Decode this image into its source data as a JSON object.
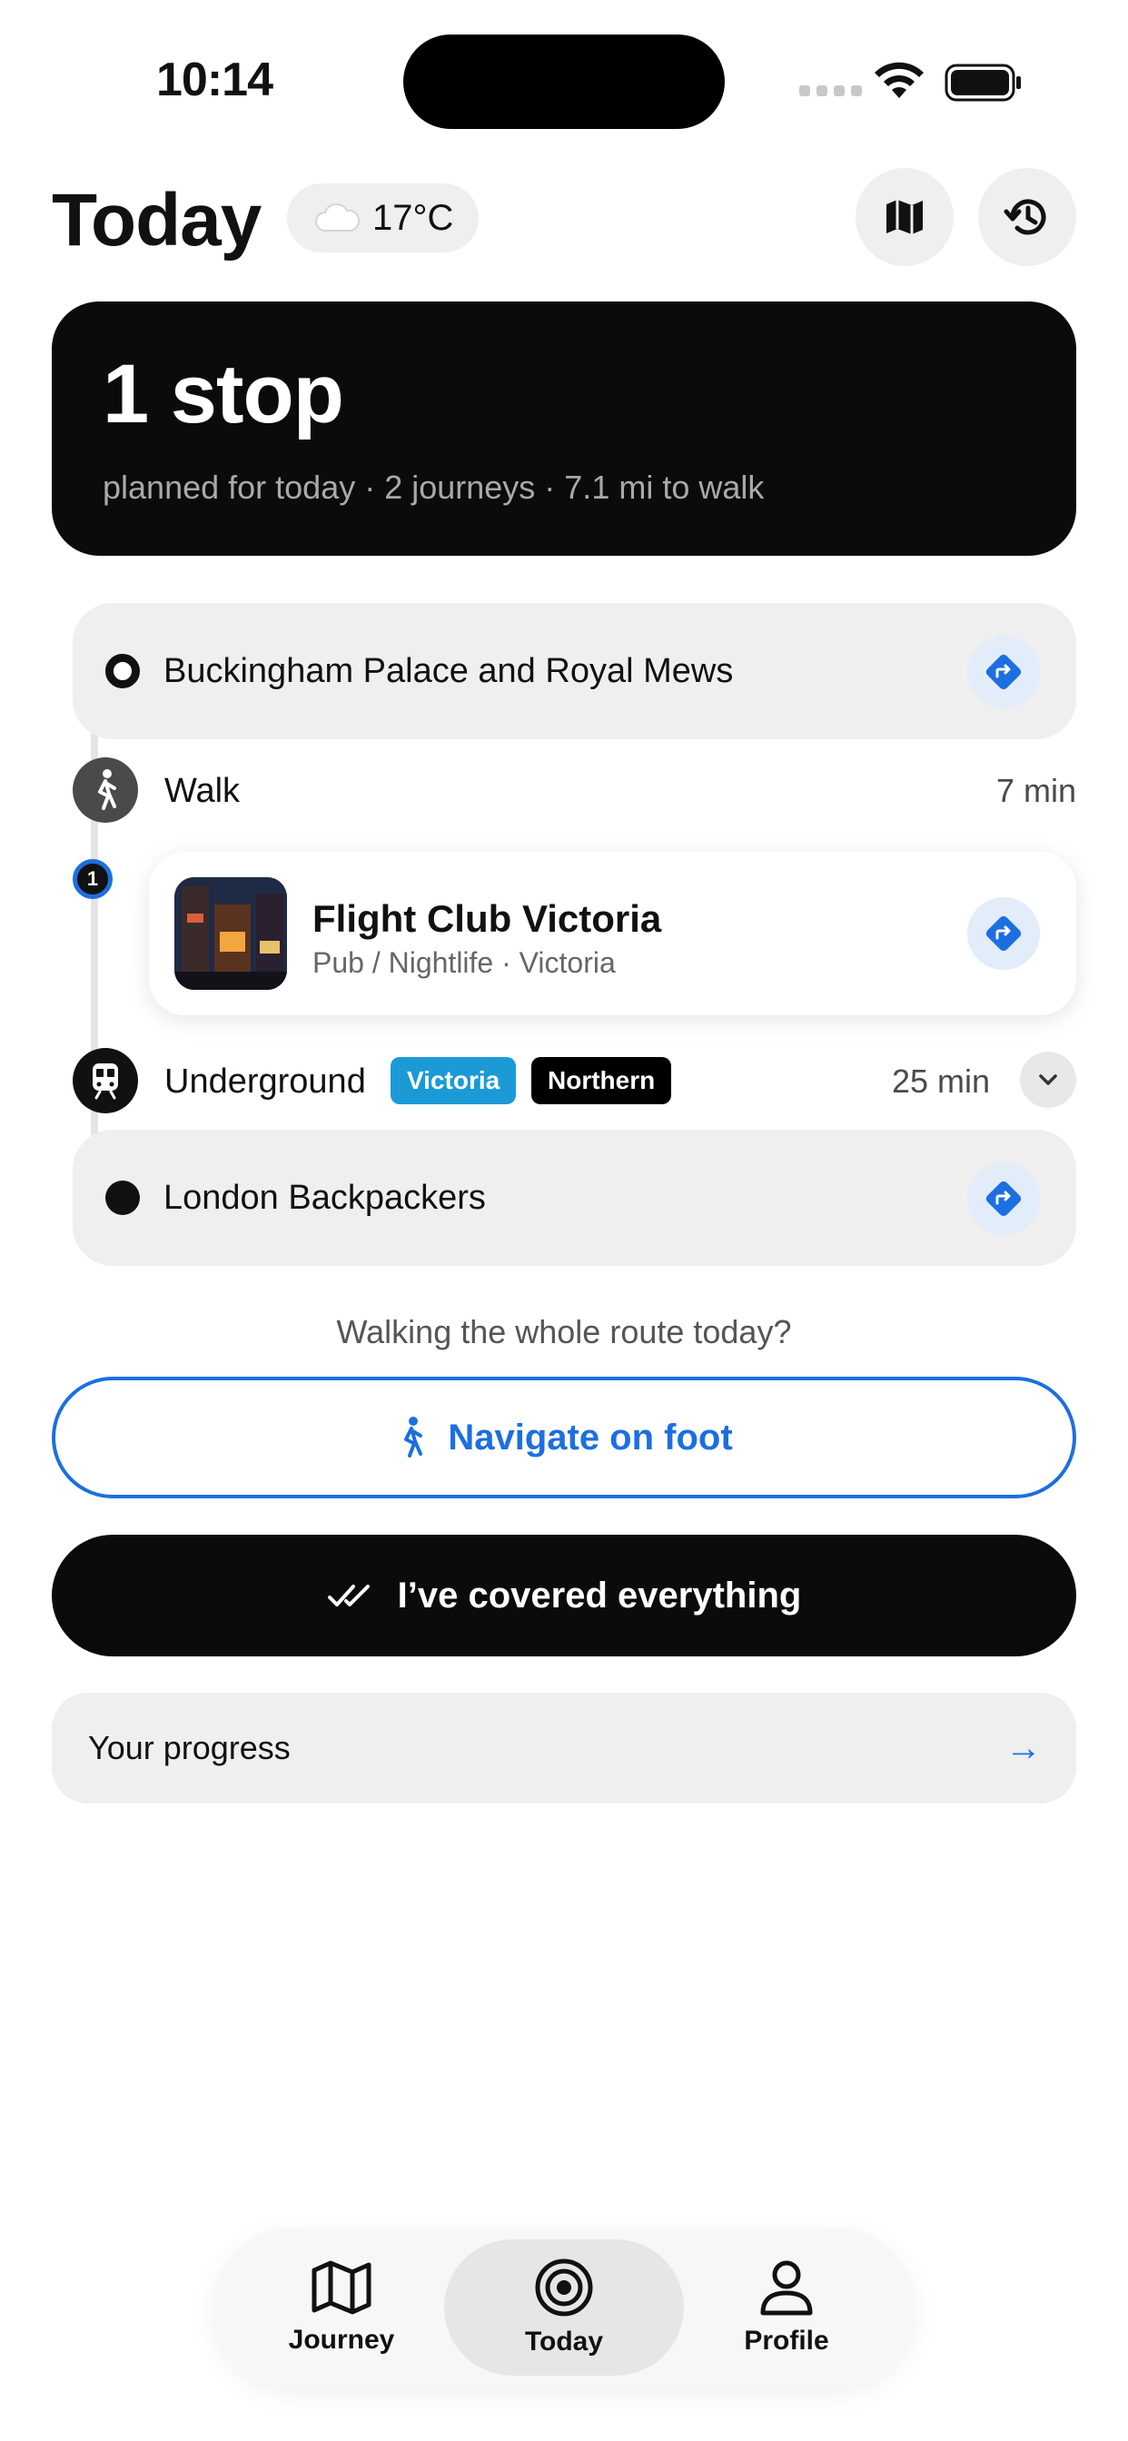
{
  "status_bar": {
    "time": "10:14"
  },
  "header": {
    "title": "Today",
    "weather_temp": "17°C",
    "weather_icon": "cloud-icon",
    "map_icon": "map-icon",
    "history_icon": "history-icon"
  },
  "summary": {
    "headline": "1 stop",
    "subtitle": "planned for today · 2 journeys · 7.1 mi to walk"
  },
  "route": {
    "start": {
      "name": "Buckingham Palace and Royal Mews"
    },
    "leg1": {
      "mode": "Walk",
      "duration": "7 min"
    },
    "stop1": {
      "number": "1",
      "name": "Flight Club Victoria",
      "meta": "Pub / Nightlife · Victoria"
    },
    "leg2": {
      "mode": "Underground",
      "lines": [
        "Victoria",
        "Northern"
      ],
      "line_colors": [
        "#1b9ad6",
        "#000000"
      ],
      "duration": "25 min"
    },
    "end": {
      "name": "London Backpackers"
    }
  },
  "actions": {
    "prompt": "Walking the whole route today?",
    "navigate_label": "Navigate on foot",
    "covered_label": "I’ve covered everything",
    "progress_label": "Your progress",
    "progress_arrow": "→"
  },
  "tabs": [
    {
      "label": "Journey",
      "icon": "map-icon"
    },
    {
      "label": "Today",
      "icon": "target-icon",
      "active": true
    },
    {
      "label": "Profile",
      "icon": "person-icon"
    }
  ],
  "colors": {
    "accent": "#1c6fe0",
    "victoria_line": "#1b9ad6",
    "northern_line": "#000000"
  }
}
